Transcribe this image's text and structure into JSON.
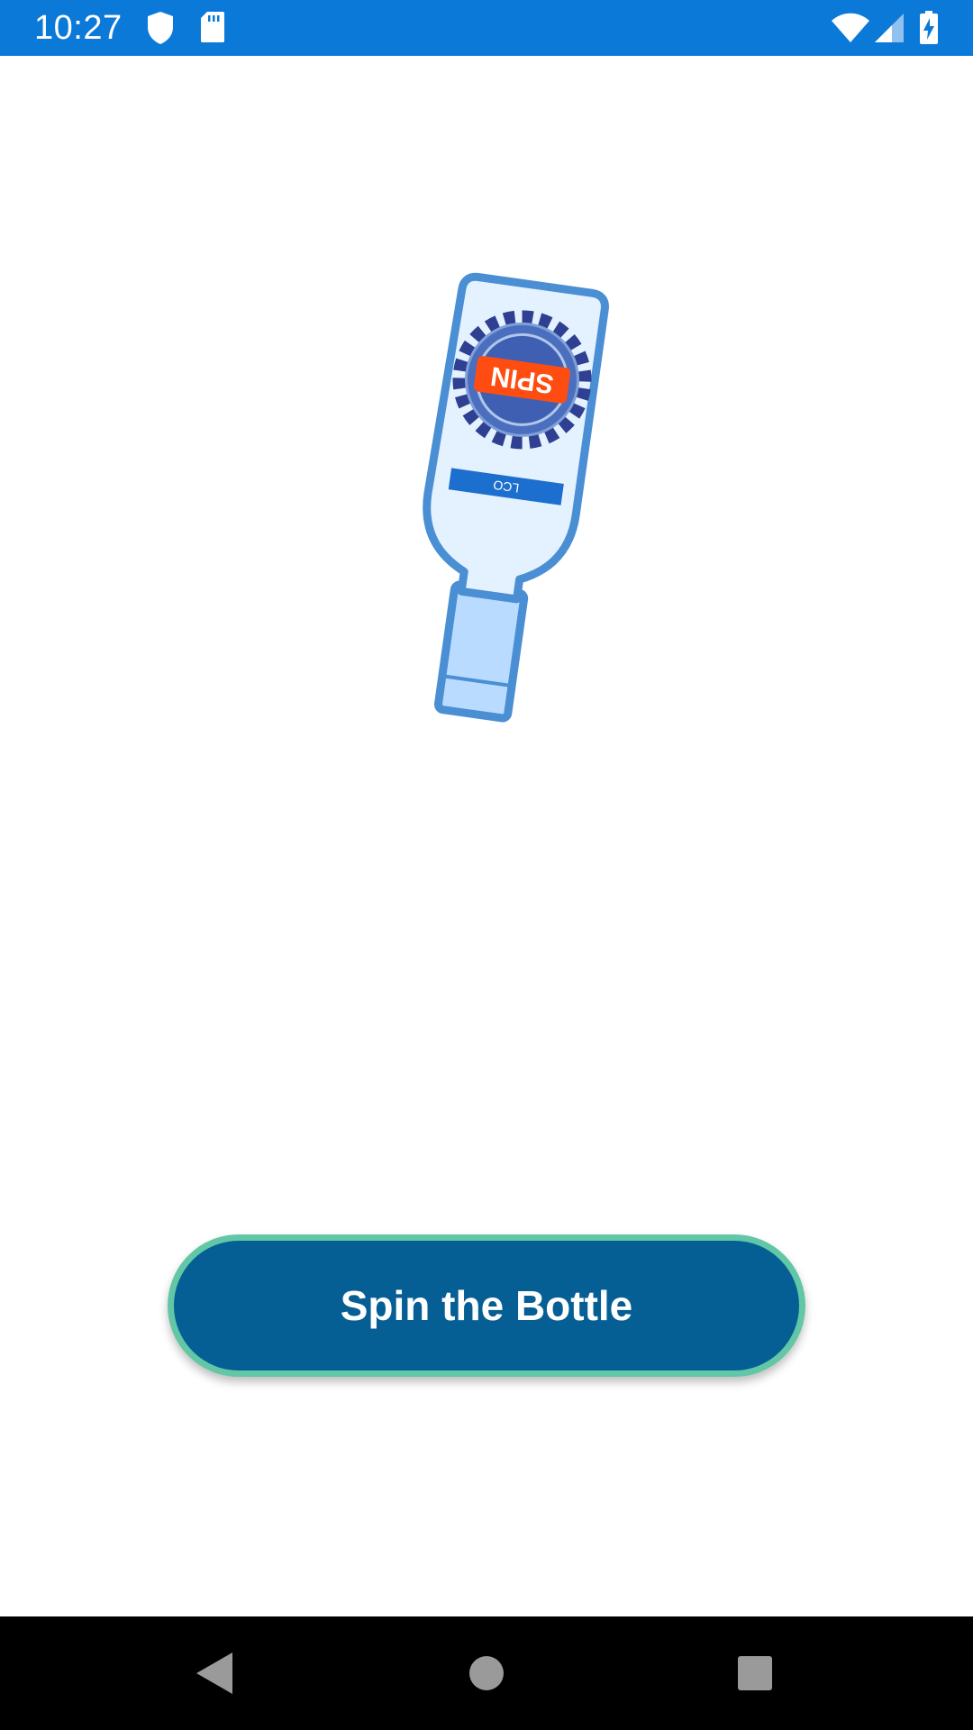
{
  "status_bar": {
    "time": "10:27",
    "background_color": "#0b79d8",
    "left_icons": [
      "shield-icon",
      "sd-card-icon"
    ],
    "right_icons": [
      "wifi-icon",
      "cell-signal-icon",
      "battery-charging-icon"
    ]
  },
  "main": {
    "bottle_label_text": "SPIN",
    "bottle_tag_text": "LCO",
    "spin_button_label": "Spin the Bottle",
    "spin_button_color": "#065f94",
    "spin_button_border_color": "#62c7a6"
  },
  "nav_bar": {
    "buttons": [
      "back-icon",
      "home-icon",
      "recents-icon"
    ]
  }
}
